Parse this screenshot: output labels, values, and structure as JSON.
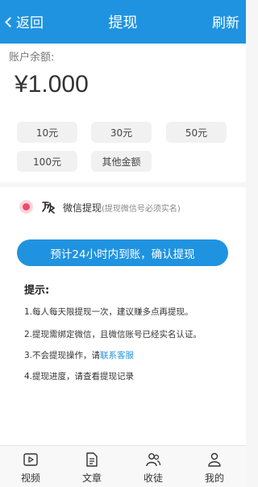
{
  "nav": {
    "back_label": "返回",
    "title": "提现",
    "refresh_label": "刷新"
  },
  "balance": {
    "label": "账户余额:",
    "amount": "¥1.000"
  },
  "amount_options": [
    "10元",
    "30元",
    "50元",
    "100元",
    "其他金额"
  ],
  "withdraw_method": {
    "name": "微信提现",
    "note": "(提现微信号必须实名)",
    "selected": true
  },
  "confirm_button": "预计24小时内到账，确认提现",
  "tips": {
    "title": "提示:",
    "items": {
      "t1": "1.每人每天限提现一次，建议赚多点再提现。",
      "t2": "2.提现需绑定微信，且微信账号已经实名认证。",
      "t3_prefix": "3.不会提现操作，请",
      "t3_link": "联系客服",
      "t4": "4.提现进度，请查看提现记录"
    }
  },
  "tabbar": [
    "视频",
    "文章",
    "收徒",
    "我的"
  ],
  "colors": {
    "primary": "#1f93e0",
    "radio": "#ef4a6c"
  }
}
